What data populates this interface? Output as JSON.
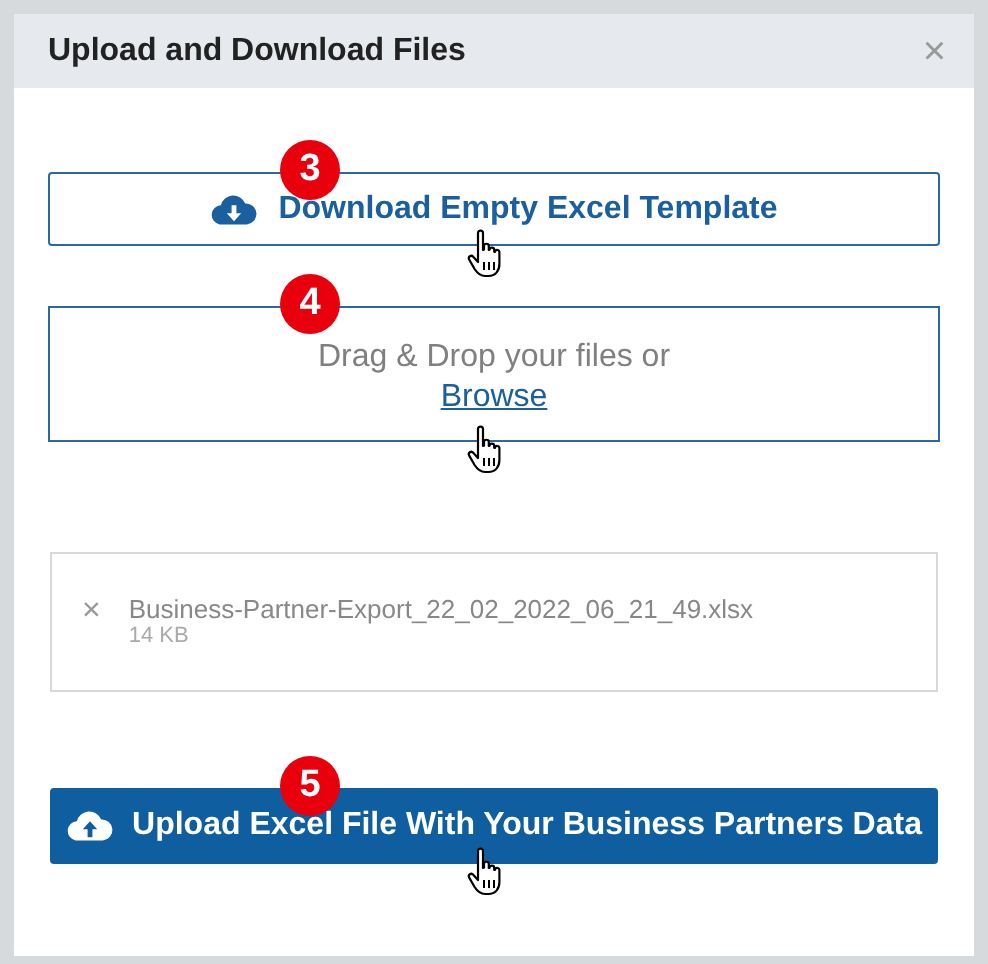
{
  "dialog": {
    "title": "Upload and Download Files",
    "close": "×"
  },
  "sections": [
    {
      "kind": "download",
      "badge": "3",
      "label": "Download Empty Excel Template"
    },
    {
      "kind": "dropzone",
      "badge": "4",
      "text": "Drag & Drop your files or",
      "link": "Browse"
    },
    {
      "kind": "file",
      "remove": "×",
      "name": "Business-Partner-Export_22_02_2022_06_21_49.xlsx",
      "size": "14 KB"
    },
    {
      "kind": "upload",
      "badge": "5",
      "label": "Upload Excel File With Your Business Partners Data"
    }
  ]
}
